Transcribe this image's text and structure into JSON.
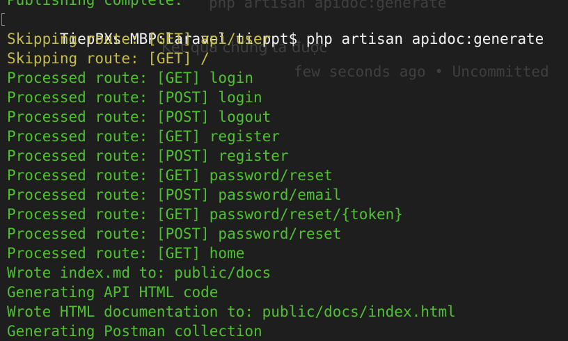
{
  "terminal": {
    "prompt": "TiepPXs-MBP:laravel tieppt$",
    "command": "php artisan apidoc:generate",
    "previous_output": "Publishing complete.",
    "output": [
      {
        "kind": "warn",
        "text": "Skipping route: [GET] api/user"
      },
      {
        "kind": "warn",
        "text": "Skipping route: [GET] /"
      },
      {
        "kind": "ok",
        "text": "Processed route: [GET] login"
      },
      {
        "kind": "ok",
        "text": "Processed route: [POST] login"
      },
      {
        "kind": "ok",
        "text": "Processed route: [POST] logout"
      },
      {
        "kind": "ok",
        "text": "Processed route: [GET] register"
      },
      {
        "kind": "ok",
        "text": "Processed route: [POST] register"
      },
      {
        "kind": "ok",
        "text": "Processed route: [GET] password/reset"
      },
      {
        "kind": "ok",
        "text": "Processed route: [POST] password/email"
      },
      {
        "kind": "ok",
        "text": "Processed route: [GET] password/reset/{token}"
      },
      {
        "kind": "ok",
        "text": "Processed route: [POST] password/reset"
      },
      {
        "kind": "ok",
        "text": "Processed route: [GET] home"
      },
      {
        "kind": "ok",
        "text": "Wrote index.md to: public/docs"
      },
      {
        "kind": "ok",
        "text": "Generating API HTML code"
      },
      {
        "kind": "ok",
        "text": "Wrote HTML documentation to: public/docs/index.html"
      },
      {
        "kind": "ok",
        "text": "Generating Postman collection"
      }
    ]
  },
  "background_ghost": {
    "command": "php artisan apidoc:generate",
    "heading": "Kết quả chúng ta được",
    "commit_note": "few seconds ago • Uncommitted"
  },
  "colors": {
    "background": "#1e1e1e",
    "prompt_text": "#f2f2f2",
    "warning_text": "#c5bd47",
    "success_text": "#4fc12f",
    "ghost_text": "#3f3f3f"
  }
}
